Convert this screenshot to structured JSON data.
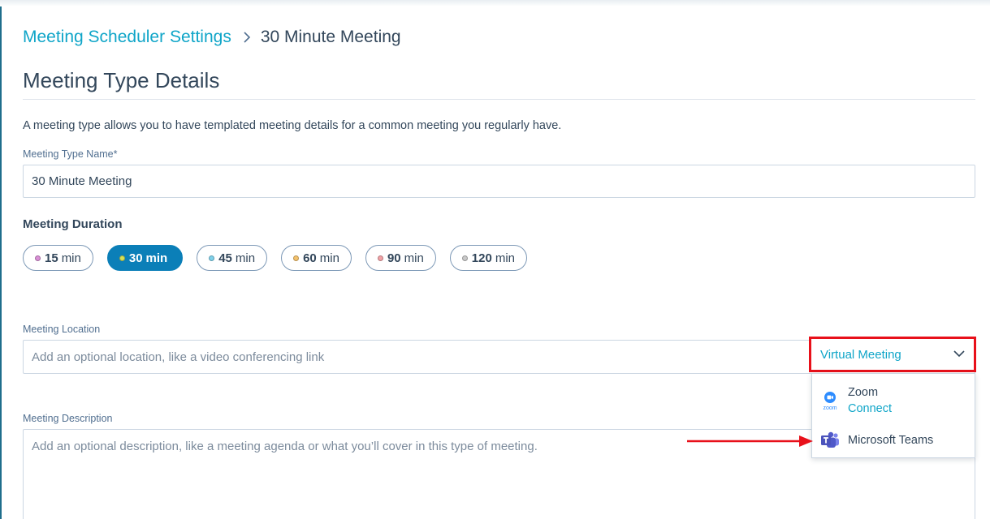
{
  "breadcrumb": {
    "parent": "Meeting Scheduler Settings",
    "current": "30 Minute Meeting"
  },
  "title": "Meeting Type Details",
  "description": "A meeting type allows you to have templated meeting details for a common meeting you regularly have.",
  "name_field": {
    "label": "Meeting Type Name*",
    "value": "30 Minute Meeting"
  },
  "duration": {
    "label": "Meeting Duration",
    "selected": "30",
    "options": [
      {
        "value": "15",
        "unit": "min",
        "color": "#d98fd6"
      },
      {
        "value": "30",
        "unit": "min",
        "color": "#d4e157"
      },
      {
        "value": "45",
        "unit": "min",
        "color": "#7fd1ea"
      },
      {
        "value": "60",
        "unit": "min",
        "color": "#f5c26b"
      },
      {
        "value": "90",
        "unit": "min",
        "color": "#f2a2a6"
      },
      {
        "value": "120",
        "unit": "min",
        "color": "#c9c9c9"
      }
    ]
  },
  "location": {
    "label": "Meeting Location",
    "placeholder": "Add an optional location, like a video conferencing link",
    "select_label": "Virtual Meeting",
    "menu": {
      "zoom": {
        "name": "Zoom",
        "action": "Connect",
        "icon": "zoom-icon",
        "logo_text": "zoom"
      },
      "teams": {
        "name": "Microsoft Teams",
        "icon": "microsoft-teams-icon"
      }
    }
  },
  "meeting_description": {
    "label": "Meeting Description",
    "placeholder": "Add an optional description, like a meeting agenda or what you’ll cover in this type of meeting."
  },
  "colors": {
    "accent": "#0fa5c8",
    "active_pill": "#0b7fb8",
    "highlight_box": "#e8101a",
    "text": "#33475b"
  }
}
